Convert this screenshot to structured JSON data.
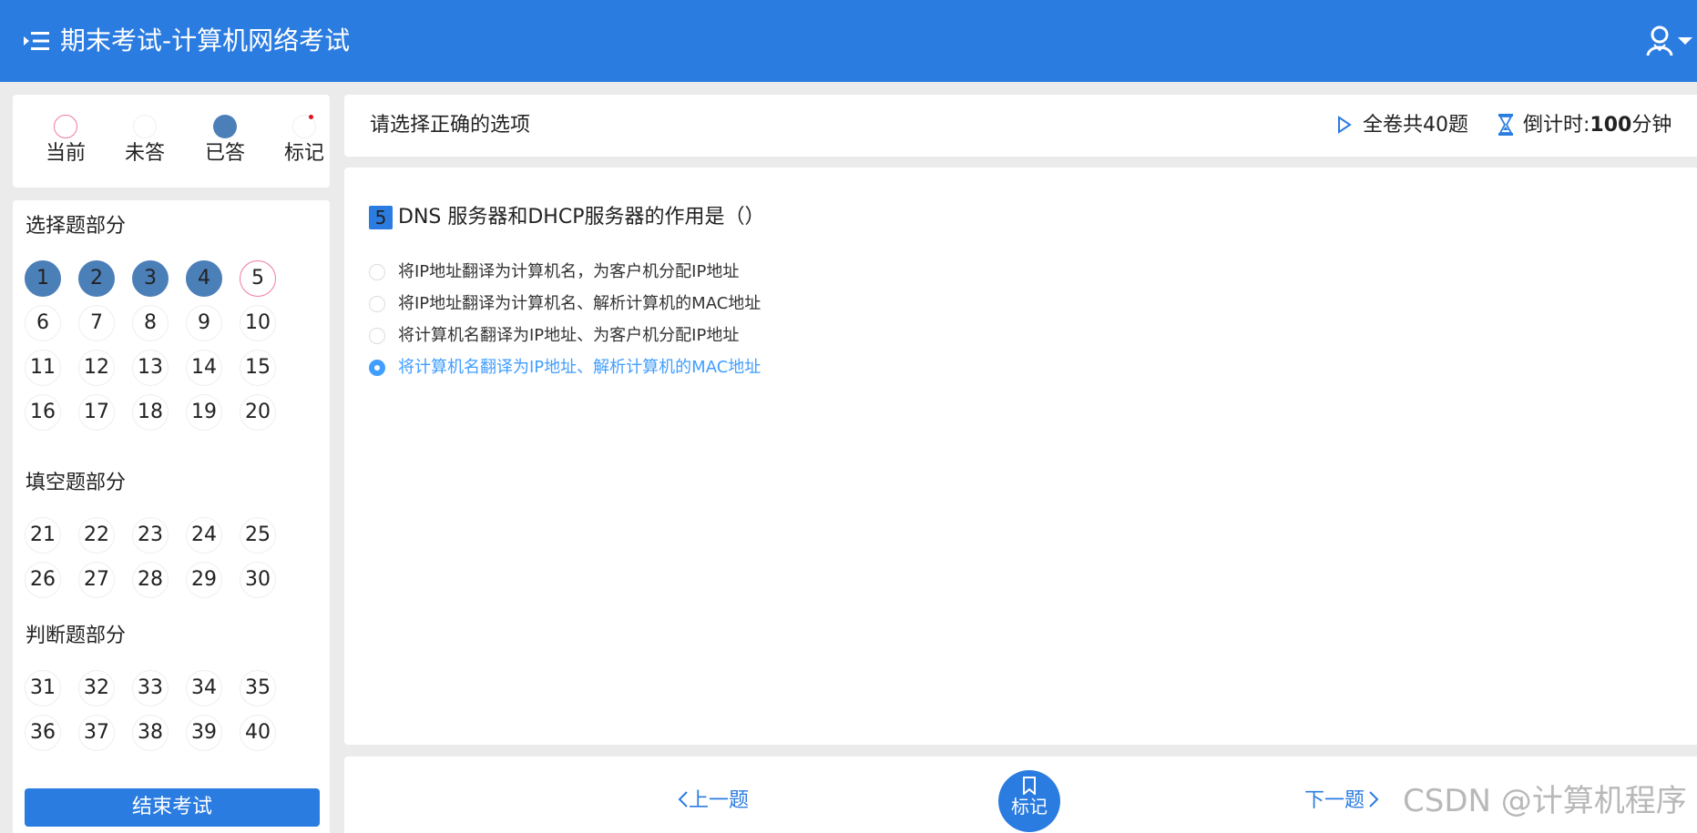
{
  "header": {
    "title": "期末考试-计算机网络考试"
  },
  "legend": {
    "current": "当前",
    "unanswered": "未答",
    "answered": "已答",
    "marked": "标记"
  },
  "nav": {
    "sections": [
      {
        "title": "选择题部分",
        "questions": [
          "1",
          "2",
          "3",
          "4",
          "5",
          "6",
          "7",
          "8",
          "9",
          "10",
          "11",
          "12",
          "13",
          "14",
          "15",
          "16",
          "17",
          "18",
          "19",
          "20"
        ]
      },
      {
        "title": "填空题部分",
        "questions": [
          "21",
          "22",
          "23",
          "24",
          "25",
          "26",
          "27",
          "28",
          "29",
          "30"
        ]
      },
      {
        "title": "判断题部分",
        "questions": [
          "31",
          "32",
          "33",
          "34",
          "35",
          "36",
          "37",
          "38",
          "39",
          "40"
        ]
      }
    ],
    "answered": [
      "1",
      "2",
      "3",
      "4"
    ],
    "current": "5",
    "end_button": "结束考试"
  },
  "info": {
    "instruction": "请选择正确的选项",
    "total": "全卷共40题",
    "timer_label": "倒计时:",
    "timer_value": "100",
    "timer_unit": "分钟"
  },
  "question": {
    "number": "5",
    "text": "DNS 服务器和DHCP服务器的作用是（）",
    "options": [
      {
        "text": "将IP地址翻译为计算机名，为客户机分配IP地址",
        "selected": false
      },
      {
        "text": "将IP地址翻译为计算机名、解析计算机的MAC地址",
        "selected": false
      },
      {
        "text": "将计算机名翻译为IP地址、为客户机分配IP地址",
        "selected": false
      },
      {
        "text": "将计算机名翻译为IP地址、解析计算机的MAC地址",
        "selected": true
      }
    ]
  },
  "footer": {
    "prev": "上一题",
    "mark": "标记",
    "next": "下一题"
  },
  "watermark": "CSDN @计算机程序",
  "colors": {
    "primary": "#2b7ce0",
    "answered": "#4b7fb8",
    "current_border": "#f07aa0",
    "selected_option": "#409eff",
    "mark_dot": "#e0141e"
  }
}
